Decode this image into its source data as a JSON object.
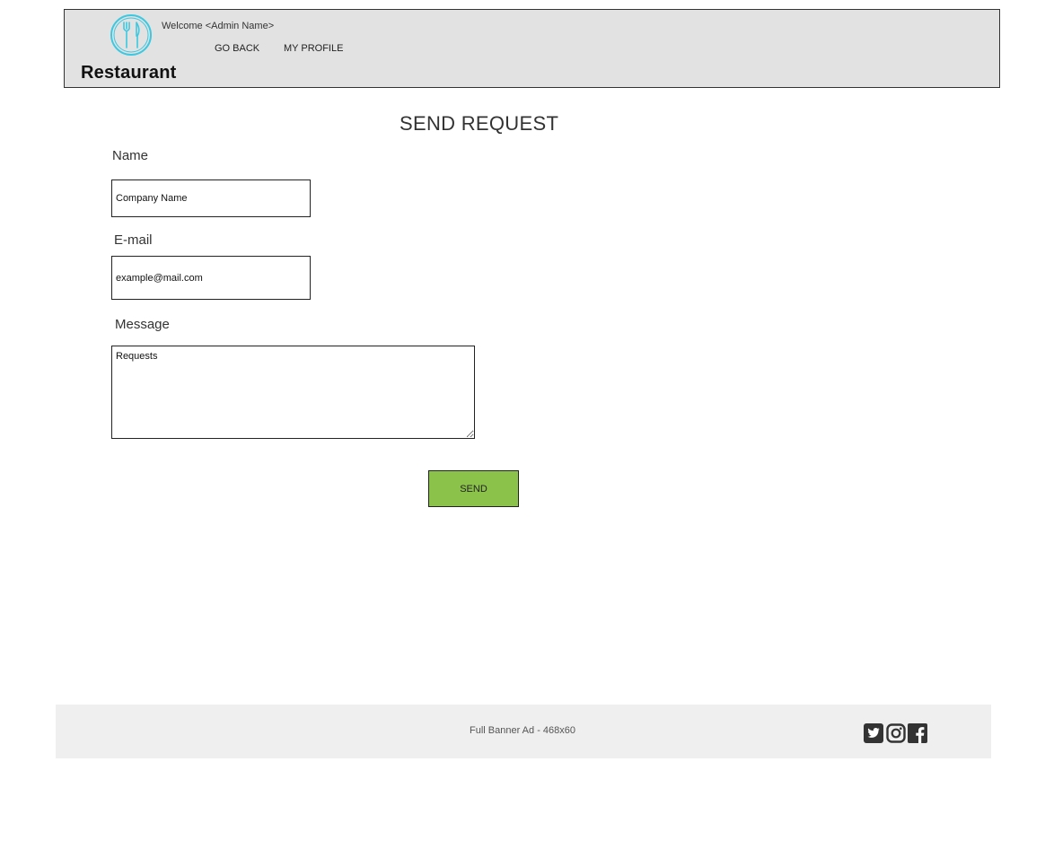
{
  "header": {
    "logo_text": "Restaurant",
    "welcome": "Welcome <Admin Name>",
    "nav": {
      "go_back": "GO BACK",
      "my_profile": "MY PROFILE"
    }
  },
  "form": {
    "title": "SEND REQUEST",
    "name": {
      "label": "Name",
      "placeholder": "Company Name"
    },
    "email": {
      "label": "E-mail",
      "placeholder": "example@mail.com"
    },
    "message": {
      "label": "Message",
      "placeholder": "Requests"
    },
    "send_label": "SEND"
  },
  "footer": {
    "ad_text": "Full Banner Ad - 468x60",
    "social_icons": [
      "twitter-icon",
      "instagram-icon",
      "facebook-icon"
    ]
  },
  "colors": {
    "header_bg": "#e2e2e2",
    "footer_bg": "#efefef",
    "send_button": "#8bc34a",
    "logo_accent": "#3cc8e0"
  }
}
